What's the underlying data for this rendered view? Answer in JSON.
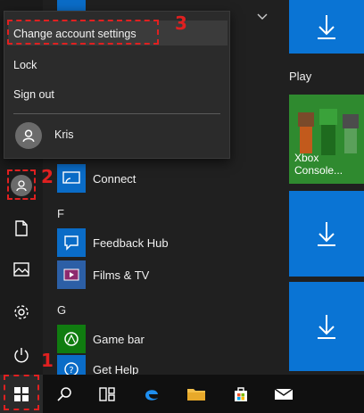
{
  "flyout": {
    "items": [
      {
        "label": "Change account settings"
      },
      {
        "label": "Lock"
      },
      {
        "label": "Sign out"
      }
    ],
    "user_name": "Kris"
  },
  "apps": {
    "connect": "Connect",
    "section_f": "F",
    "feedback_hub": "Feedback Hub",
    "films_tv": "Films & TV",
    "section_g": "G",
    "game_bar": "Game bar",
    "get_help": "Get Help"
  },
  "tiles": {
    "group_label": "Play",
    "xbox_label": "Xbox Console..."
  },
  "annotations": {
    "step1": "1",
    "step2": "2",
    "step3": "3"
  },
  "colors": {
    "accent": "#0a74d4",
    "annotation": "#e02020"
  },
  "icons": [
    "chevron-down-icon",
    "download-arrow-icon",
    "user-icon",
    "document-icon",
    "pictures-icon",
    "settings-icon",
    "power-icon",
    "windows-logo-icon",
    "search-icon",
    "task-view-icon",
    "edge-icon",
    "folder-icon",
    "store-icon",
    "mail-icon"
  ]
}
